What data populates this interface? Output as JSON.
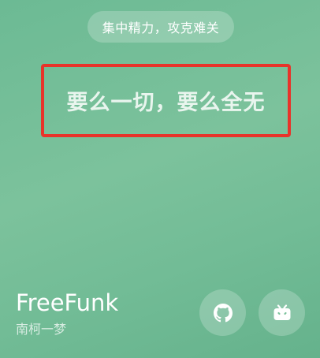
{
  "motto_pill": {
    "label": "集中精力，攻克难关"
  },
  "headline": {
    "text": "要么一切，要么全无"
  },
  "brand": {
    "name": "FreeFunk",
    "subtitle": "南柯一梦"
  },
  "social": [
    {
      "name": "github",
      "icon": "github-icon"
    },
    {
      "name": "bilibili",
      "icon": "bilibili-icon"
    }
  ],
  "colors": {
    "background": "#72bc96",
    "highlight_border": "#e8332a"
  }
}
